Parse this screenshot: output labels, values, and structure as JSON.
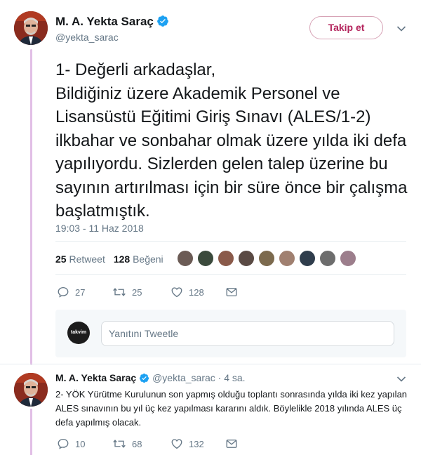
{
  "main_tweet": {
    "author_name": "M. A. Yekta Saraç",
    "author_handle": "@yekta_sarac",
    "follow_label": "Takip et",
    "text": "1- Değerli arkadaşlar,\nBildiğiniz üzere Akademik Personel ve Lisansüstü Eğitimi Giriş Sınavı (ALES/1-2) ilkbahar ve sonbahar olmak üzere yılda iki defa yapılıyordu. Sizlerden gelen talep üzerine bu sayının artırılması için bir süre önce bir çalışma başlatmıştık.",
    "timestamp": "19:03 - 11 Haz 2018",
    "retweet_count": "25",
    "retweet_label": "Retweet",
    "like_count": "128",
    "like_label": "Beğeni",
    "actions": {
      "reply_count": "27",
      "retweet_count": "25",
      "like_count": "128"
    }
  },
  "reply_box": {
    "avatar_text": "takvim",
    "placeholder": "Yanıtını Tweetle"
  },
  "reply_tweet": {
    "author_name": "M. A. Yekta Saraç",
    "author_handle": "@yekta_sarac",
    "time": "· 4 sa.",
    "text": "2- YÖK Yürütme Kurulunun son yapmış olduğu toplantı sonrasında yılda iki kez yapılan ALES sınavının bu yıl üç kez yapılması kararını aldık. Böylelikle 2018 yılında ALES üç defa yapılmış olacak.",
    "actions": {
      "reply_count": "10",
      "retweet_count": "68",
      "like_count": "132"
    }
  },
  "colors": {
    "verified": "#1da1f2",
    "follow": "#b4245c",
    "thread_line": "#e1bfe6",
    "muted": "#657786"
  }
}
